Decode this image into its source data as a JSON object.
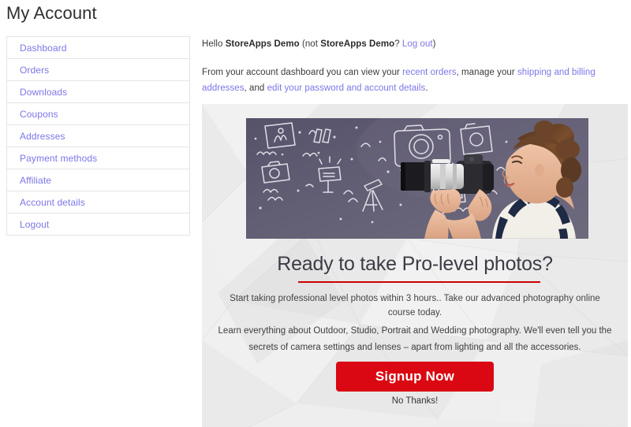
{
  "page": {
    "title": "My Account"
  },
  "sidebar": {
    "items": [
      {
        "label": "Dashboard"
      },
      {
        "label": "Orders"
      },
      {
        "label": "Downloads"
      },
      {
        "label": "Coupons"
      },
      {
        "label": "Addresses"
      },
      {
        "label": "Payment methods"
      },
      {
        "label": "Affiliate"
      },
      {
        "label": "Account details"
      },
      {
        "label": "Logout"
      }
    ]
  },
  "main": {
    "greeting": {
      "hello": "Hello ",
      "user_name": "StoreApps Demo",
      "not_prefix": " (not ",
      "not_user_name": "StoreApps Demo",
      "question": "? ",
      "logout_link": "Log out",
      "close": ")"
    },
    "intro": {
      "part1": "From your account dashboard you can view your ",
      "link1": "recent orders",
      "part2": ", manage your ",
      "link2": "shipping and billing addresses",
      "part3": ", and ",
      "link3": "edit your password and account details",
      "part4": "."
    }
  },
  "promo": {
    "headline": "Ready to take Pro-level photos?",
    "subtext": "Start taking professional level photos within 3 hours.. Take our advanced photography online course today.",
    "body": "Learn everything about Outdoor, Studio, Portrait and Wedding photography. We'll even tell you the secrets of camera settings and lenses – apart from lighting and all the accessories.",
    "cta_label": "Signup Now",
    "decline_label": "No Thanks!",
    "image_alt": "woman photographer with telephoto lens and chalk camera doodles"
  },
  "colors": {
    "link": "#7c76e8",
    "cta_background": "#da0812",
    "cta_text": "#ffffff",
    "headline_rule": "#cc0000",
    "banner_background": "#ececec",
    "photo_wall": "#5e5a6e"
  }
}
